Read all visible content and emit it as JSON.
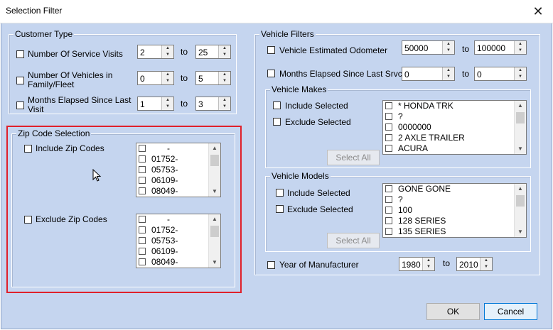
{
  "window": {
    "title": "Selection Filter",
    "close_glyph": "✕"
  },
  "customer_type": {
    "legend": "Customer Type",
    "rows": [
      {
        "label": "Number Of Service Visits",
        "from": "2",
        "to": "25"
      },
      {
        "label": "Number Of Vehicles in Family/Fleet",
        "from": "0",
        "to": "5"
      },
      {
        "label": "Months Elapsed Since Last Visit",
        "from": "1",
        "to": "3"
      }
    ],
    "to_label": "to"
  },
  "zip": {
    "legend": "Zip Code Selection",
    "include_label": "Include Zip Codes",
    "exclude_label": "Exclude Zip Codes",
    "items": [
      "-",
      "01752-",
      "05753-",
      "06109-",
      "08049-"
    ]
  },
  "vehicle_filters": {
    "legend": "Vehicle Filters",
    "odometer_label": "Vehicle Estimated Odometer",
    "odometer_from": "50000",
    "odometer_to": "100000",
    "months_label": "Months Elapsed Since Last Srvc",
    "months_from": "0",
    "months_to": "0",
    "to_label": "to",
    "year_label": "Year of Manufacturer",
    "year_from": "1980",
    "year_to": "2010"
  },
  "makes": {
    "legend": "Vehicle Makes",
    "include_label": "Include Selected",
    "exclude_label": "Exclude Selected",
    "select_all": "Select All",
    "items": [
      "* HONDA TRK",
      "?",
      "0000000",
      "2 AXLE TRAILER",
      "ACURA"
    ]
  },
  "models": {
    "legend": "Vehicle Models",
    "include_label": "Include Selected",
    "exclude_label": "Exclude Selected",
    "select_all": "Select All",
    "items": [
      "GONE GONE",
      "?",
      "100",
      "128 SERIES",
      "135 SERIES"
    ]
  },
  "footer": {
    "ok": "OK",
    "cancel": "Cancel"
  },
  "colors": {
    "client_bg": "#c5d5ef",
    "highlight": "#e0202a"
  }
}
